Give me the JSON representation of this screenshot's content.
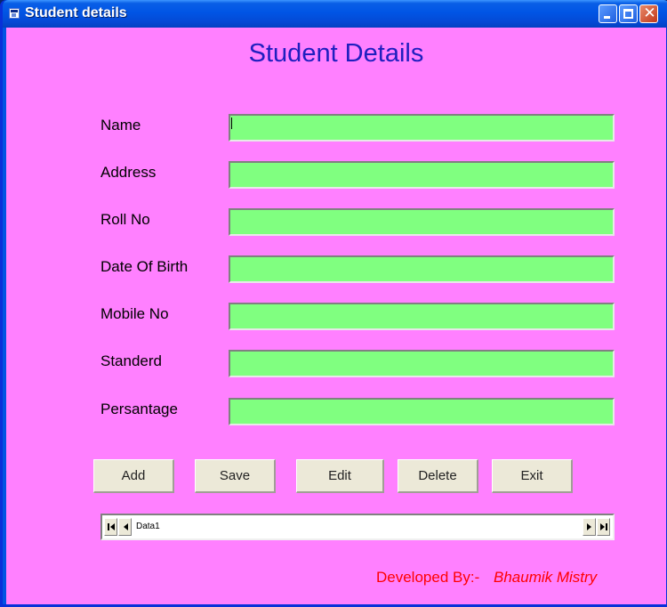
{
  "window": {
    "title": "Student details",
    "controls": {
      "minimize_icon": "minimize-icon",
      "maximize_icon": "maximize-icon",
      "close_icon": "close-icon",
      "close_glyph": "✕"
    }
  },
  "form": {
    "heading": "Student Details",
    "fields": [
      {
        "label": "Name",
        "value": ""
      },
      {
        "label": "Address",
        "value": ""
      },
      {
        "label": "Roll No",
        "value": ""
      },
      {
        "label": "Date Of Birth",
        "value": ""
      },
      {
        "label": "Mobile No",
        "value": ""
      },
      {
        "label": "Standerd",
        "value": ""
      },
      {
        "label": "Persantage",
        "value": ""
      }
    ]
  },
  "buttons": {
    "add": "Add",
    "save": "Save",
    "edit": "Edit",
    "delete": "Delete",
    "exit": "Exit"
  },
  "data_control": {
    "caption": "Data1",
    "icons": [
      "first-record-icon",
      "previous-record-icon",
      "next-record-icon",
      "last-record-icon"
    ]
  },
  "footer": {
    "label": "Developed By:-",
    "author": "Bhaumik Mistry"
  },
  "colors": {
    "form_background": "#ff80ff",
    "heading": "#1f1fbf",
    "input_background": "#80ff80",
    "footer_text": "#ff0000",
    "button_face": "#ece9d8"
  }
}
